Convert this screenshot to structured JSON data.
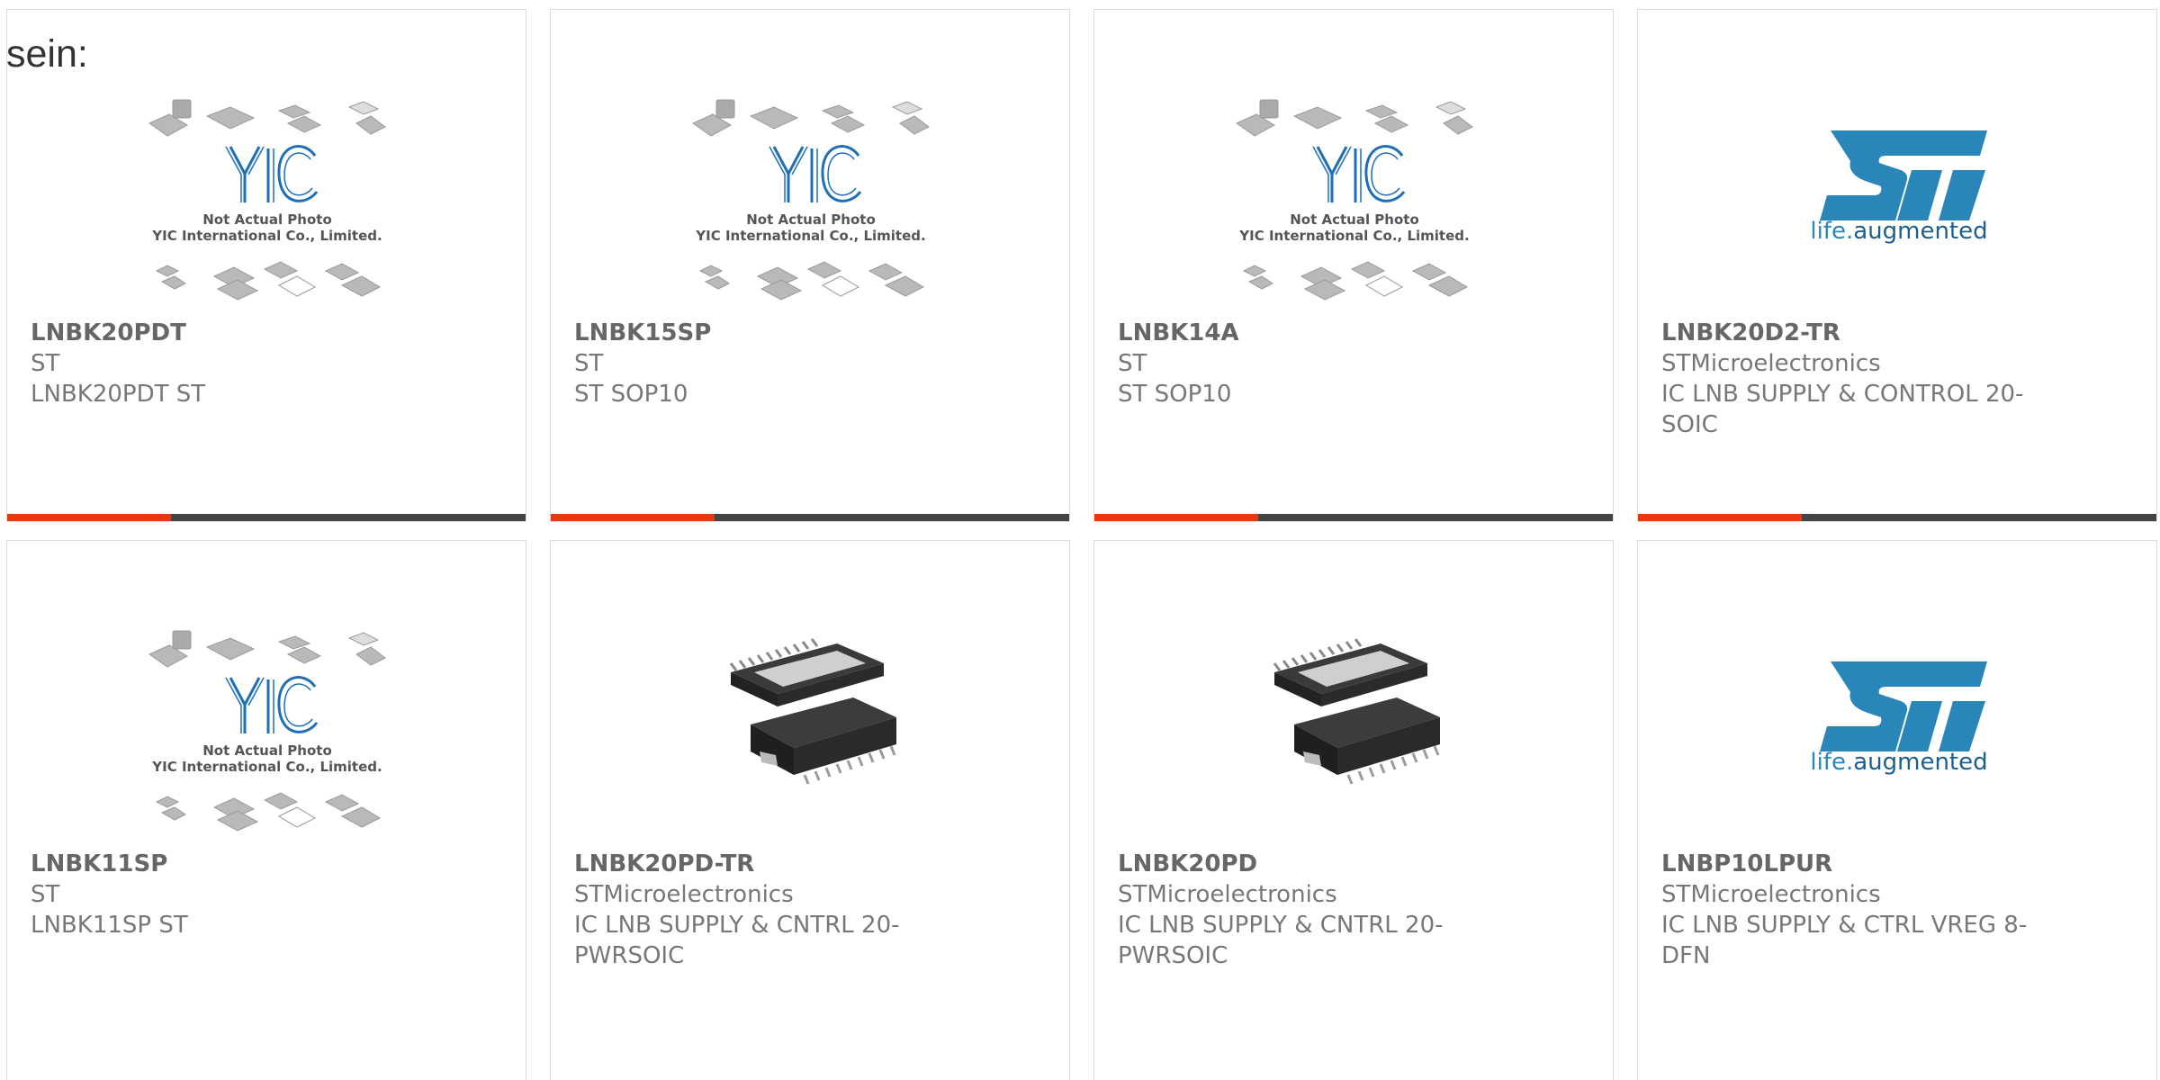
{
  "intro_text": "sein:",
  "colors": {
    "accent": "#e8380d",
    "bar_dark": "#444444",
    "yic_blue": "#1e6fb8",
    "st_blue": "#2a86b9"
  },
  "products": [
    {
      "name": "LNBK20PDT",
      "manufacturer": "ST",
      "description": "LNBK20PDT ST",
      "image": "yic-placeholder"
    },
    {
      "name": "LNBK15SP",
      "manufacturer": "ST",
      "description": "ST SOP10",
      "image": "yic-placeholder"
    },
    {
      "name": "LNBK14A",
      "manufacturer": "ST",
      "description": "ST SOP10",
      "image": "yic-placeholder"
    },
    {
      "name": "LNBK20D2-TR",
      "manufacturer": "STMicroelectronics",
      "description": "IC LNB SUPPLY & CONTROL 20-SOIC",
      "image": "st-logo"
    },
    {
      "name": "LNBK11SP",
      "manufacturer": "ST",
      "description": "LNBK11SP ST",
      "image": "yic-placeholder"
    },
    {
      "name": "LNBK20PD-TR",
      "manufacturer": "STMicroelectronics",
      "description": "IC LNB SUPPLY & CNTRL 20-PWRSOIC",
      "image": "ic-chip-photo"
    },
    {
      "name": "LNBK20PD",
      "manufacturer": "STMicroelectronics",
      "description": "IC LNB SUPPLY & CNTRL 20-PWRSOIC",
      "image": "ic-chip-photo"
    },
    {
      "name": "LNBP10LPUR",
      "manufacturer": "STMicroelectronics",
      "description": "IC LNB SUPPLY & CTRL VREG 8-DFN",
      "image": "st-logo"
    }
  ],
  "placeholder": {
    "line1": "Not Actual Photo",
    "line2": "YIC International Co., Limited.",
    "logo_text": "YIC"
  },
  "st_logo": {
    "mark": "ST",
    "tagline_a": "life.",
    "tagline_b": "augmented"
  }
}
